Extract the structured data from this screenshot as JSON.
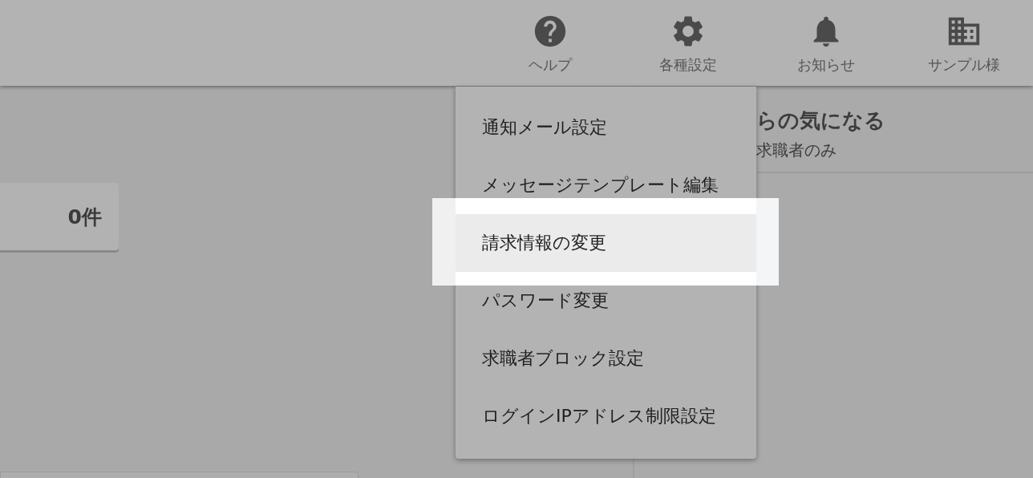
{
  "header": {
    "nav": [
      {
        "label": "ヘルプ"
      },
      {
        "label": "各種設定"
      },
      {
        "label": "お知らせ"
      },
      {
        "label": "サンプル様"
      }
    ]
  },
  "count_card": {
    "value": "0件"
  },
  "side_panel": {
    "title": "らの気になる",
    "subtitle": "求職者のみ"
  },
  "menu": {
    "items": [
      {
        "label": "通知メール設定",
        "selected": false
      },
      {
        "label": "メッセージテンプレート編集",
        "selected": false
      },
      {
        "label": "請求情報の変更",
        "selected": true
      },
      {
        "label": "パスワード変更",
        "selected": false
      },
      {
        "label": "求職者ブロック設定",
        "selected": false
      },
      {
        "label": "ログインIPアドレス制限設定",
        "selected": false
      }
    ]
  }
}
